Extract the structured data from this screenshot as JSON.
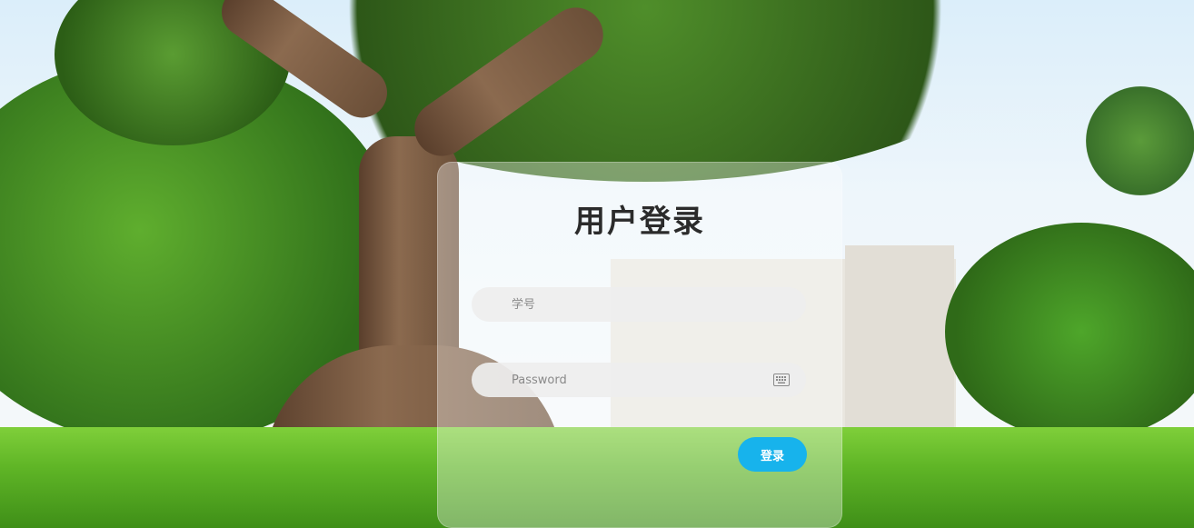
{
  "login": {
    "title": "用户登录",
    "student_id": {
      "value": "",
      "placeholder": "学号"
    },
    "password": {
      "value": "",
      "placeholder": "Password"
    },
    "submit_label": "登录"
  },
  "colors": {
    "accent": "#17b3ec",
    "card": "rgba(255,255,255,0.35)",
    "field": "#eeeeee",
    "title": "#2b2b2b"
  },
  "icons": {
    "password_field_icon": "keyboard-icon"
  }
}
